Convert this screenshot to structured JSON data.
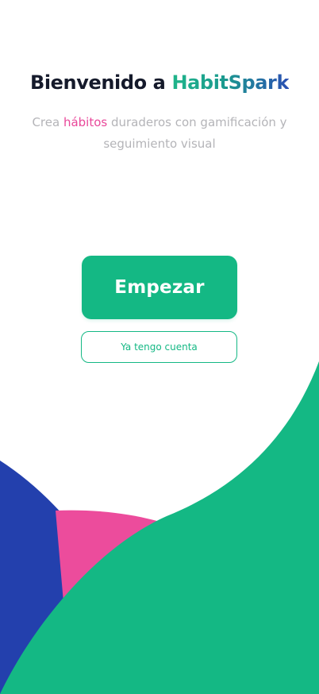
{
  "welcome": {
    "title_prefix": "Bienvenido a ",
    "brand_name": "HabitSpark",
    "subtitle_part1": "Crea ",
    "subtitle_highlight": "hábitos",
    "subtitle_part2": " duraderos con gamificación y seguimiento visual"
  },
  "actions": {
    "primary_label": "Empezar",
    "secondary_label": "Ya tengo cuenta"
  },
  "colors": {
    "brand_gradient_start": "#1fb58a",
    "brand_gradient_end": "#2a4fb3",
    "accent_green": "#14b884",
    "accent_pink": "#e9489a",
    "accent_blue": "#2340ad",
    "title_text": "#151a2b",
    "subtitle_text": "#b4b4b8"
  }
}
